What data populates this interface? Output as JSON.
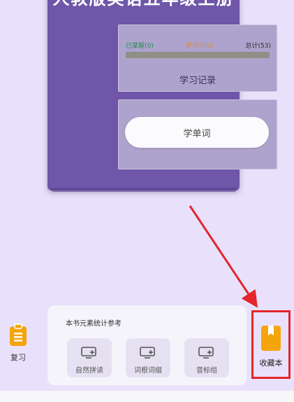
{
  "book": {
    "title": "人教版英语五年级上册",
    "stats": {
      "mastered": "已掌握(0)",
      "learning": "学习中(0)",
      "total": "总计(53)"
    },
    "progress_fraction": 0,
    "record_label": "学习记录",
    "learn_button": "学单词"
  },
  "left_nav": {
    "review_label": "复习"
  },
  "stats_card": {
    "title": "本书元素统计参考",
    "chips": [
      {
        "label": "自然拼读",
        "icon": "card-add-icon"
      },
      {
        "label": "词根词缀",
        "icon": "card-add-icon"
      },
      {
        "label": "音标组",
        "icon": "card-add-icon"
      }
    ]
  },
  "right_nav": {
    "favorites_label": "收藏本"
  },
  "colors": {
    "background": "#e9e1fb",
    "book": "#6f56a8",
    "mastered": "#1f8f4a",
    "learning": "#e7862a",
    "accent_orange": "#f5a40c",
    "highlight_red": "#e3262b"
  }
}
